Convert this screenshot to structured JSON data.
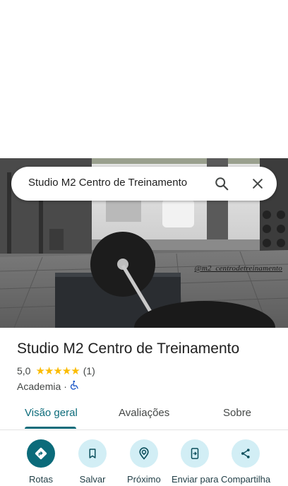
{
  "search": {
    "query": "Studio M2 Centro de Treinamento",
    "search_icon": "search-icon",
    "close_icon": "close-icon"
  },
  "photo": {
    "watermark": "@m2_centrodetreinamento"
  },
  "place": {
    "name": "Studio M2 Centro de Treinamento",
    "rating": "5,0",
    "stars": "★★★★★",
    "review_count": "(1)",
    "category": "Academia",
    "separator": "·",
    "accessibility_icon": "wheelchair-icon"
  },
  "tabs": [
    {
      "label": "Visão geral",
      "active": true
    },
    {
      "label": "Avaliações",
      "active": false
    },
    {
      "label": "Sobre",
      "active": false
    }
  ],
  "actions": [
    {
      "label": "Rotas",
      "icon": "directions-icon",
      "primary": true
    },
    {
      "label": "Salvar",
      "icon": "bookmark-icon",
      "primary": false
    },
    {
      "label": "Próximo",
      "icon": "nearby-icon",
      "primary": false
    },
    {
      "label": "Enviar para",
      "icon": "send-to-phone-icon",
      "primary": false
    },
    {
      "label": "Compartilha",
      "icon": "share-icon",
      "primary": false
    }
  ],
  "colors": {
    "accent": "#0b6b7a",
    "action_bg": "#d2eef5",
    "star": "#fbbc04"
  }
}
